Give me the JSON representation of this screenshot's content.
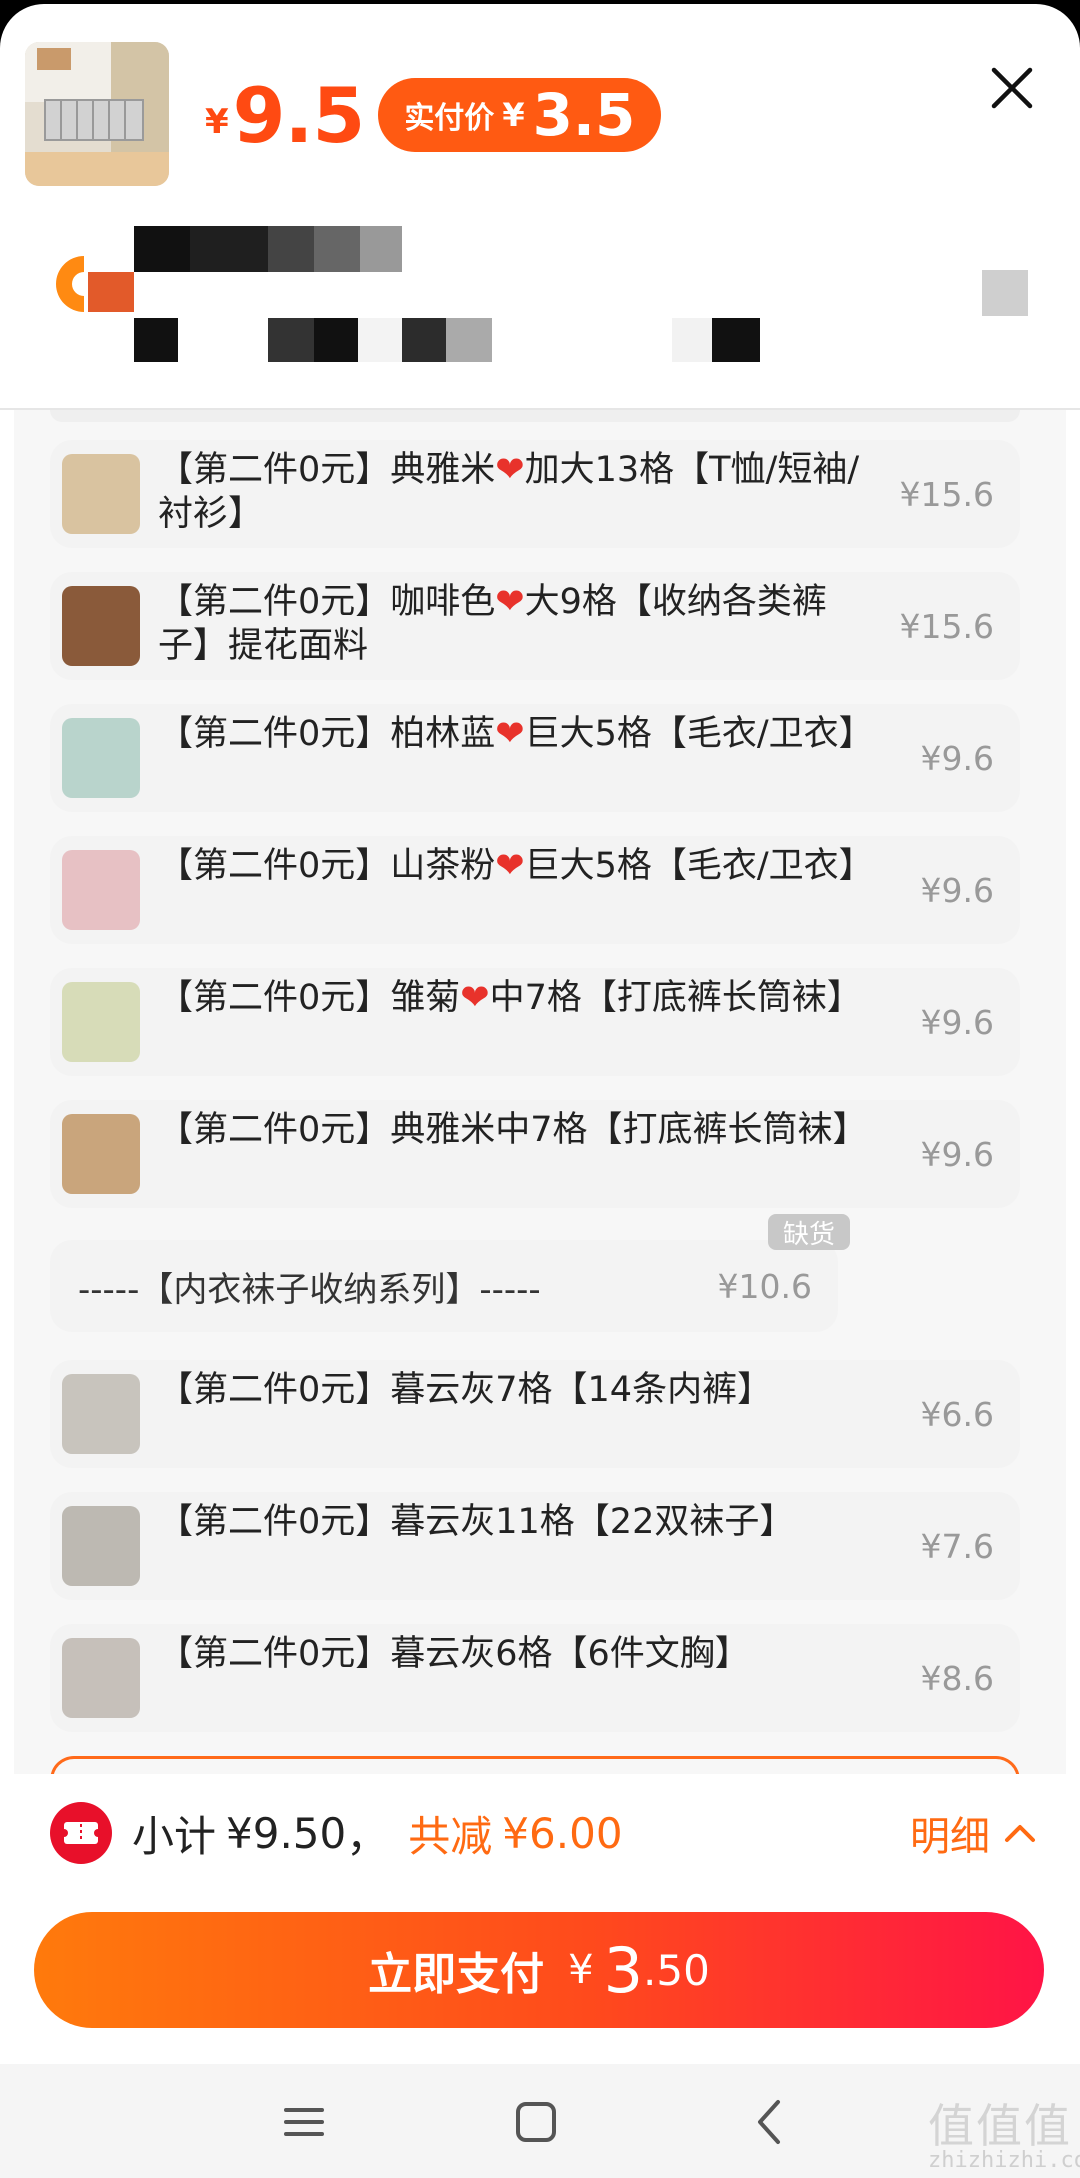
{
  "header": {
    "price_currency": "¥",
    "price_value": "9.5",
    "real_price_label": "实付价",
    "real_price_currency": "¥",
    "real_price_value": "3.5"
  },
  "items": [
    {
      "label": "【第二件0元】典雅米❤️加大13格【T恤/短袖/衬衫】",
      "label_a": "【第二件0元】典雅米",
      "label_b": "加大13格【T恤/短袖/衬衫】",
      "price": "¥15.6",
      "thumb_color": "#d9c3a0"
    },
    {
      "label": "【第二件0元】咖啡色❤️大9格【收纳各类裤子】提花面料",
      "label_a": "【第二件0元】咖啡色",
      "label_b": "大9格【收纳各类裤子】提花面料",
      "price": "¥15.6",
      "thumb_color": "#8a5a3a"
    },
    {
      "label": "【第二件0元】柏林蓝❤️巨大5格【毛衣/卫衣】",
      "label_a": "【第二件0元】柏林蓝",
      "label_b": "巨大5格【毛衣/卫衣】",
      "price": "¥9.6",
      "thumb_color": "#b9d4cc"
    },
    {
      "label": "【第二件0元】山茶粉❤️巨大5格【毛衣/卫衣】",
      "label_a": "【第二件0元】山茶粉",
      "label_b": "巨大5格【毛衣/卫衣】",
      "price": "¥9.6",
      "thumb_color": "#e7c1c4"
    },
    {
      "label": "【第二件0元】雏菊❤️中7格【打底裤长筒袜】",
      "label_a": "【第二件0元】雏菊",
      "label_b": "中7格【打底裤长筒袜】",
      "price": "¥9.6",
      "thumb_color": "#d7dcb8"
    },
    {
      "label": "【第二件0元】典雅米中7格【打底裤长筒袜】",
      "label_a": "【第二件0元】典雅米中7格【打底裤长筒袜】",
      "label_b": "",
      "price": "¥9.6",
      "thumb_color": "#c9a57c"
    }
  ],
  "series": {
    "label": "-----【内衣袜子收纳系列】-----",
    "price": "¥10.6",
    "badge": "缺货"
  },
  "items2": [
    {
      "label": "【第二件0元】暮云灰7格【14条内裤】",
      "price": "¥6.6",
      "thumb_color": "#c8c4bd"
    },
    {
      "label": "【第二件0元】暮云灰11格【22双袜子】",
      "price": "¥7.6",
      "thumb_color": "#bdb9b2"
    },
    {
      "label": "【第二件0元】暮云灰6格【6件文胸】",
      "price": "¥8.6",
      "thumb_color": "#c6c0ba"
    }
  ],
  "footer": {
    "subtotal_label": "小计",
    "subtotal_value": "¥9.50",
    "separator": "，",
    "save_label": "共减",
    "save_value": "¥6.00",
    "detail_label": "明细",
    "pay_label": "立即支付",
    "pay_currency": "¥",
    "pay_integer": "3",
    "pay_decimal": ".50"
  },
  "watermark": {
    "text": "zhizhizhi.com",
    "glyphs": "值值值"
  },
  "colors": {
    "accent": "#ff4a12",
    "pay_gradient_start": "#ff7a0c",
    "pay_gradient_end": "#ff1446"
  }
}
